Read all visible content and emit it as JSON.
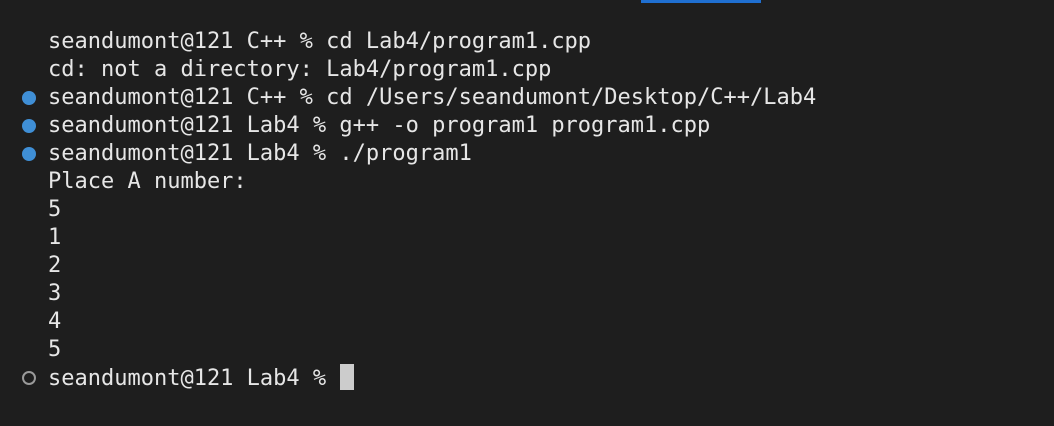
{
  "terminal": {
    "lines": [
      {
        "status": "error",
        "text": "seandumont@121 C++ % cd Lab4/program1.cpp"
      },
      {
        "status": "none",
        "text": "cd: not a directory: Lab4/program1.cpp"
      },
      {
        "status": "ok",
        "text": "seandumont@121 C++ % cd /Users/seandumont/Desktop/C++/Lab4"
      },
      {
        "status": "ok",
        "text": "seandumont@121 Lab4 % g++ -o program1 program1.cpp"
      },
      {
        "status": "ok",
        "text": "seandumont@121 Lab4 % ./program1"
      },
      {
        "status": "none",
        "text": "Place A number:"
      },
      {
        "status": "none",
        "text": "5"
      },
      {
        "status": "none",
        "text": "1"
      },
      {
        "status": "none",
        "text": "2"
      },
      {
        "status": "none",
        "text": "3"
      },
      {
        "status": "none",
        "text": "4"
      },
      {
        "status": "none",
        "text": "5"
      },
      {
        "status": "pending",
        "text": "seandumont@121 Lab4 %"
      }
    ]
  },
  "colors": {
    "background": "#1e1e1e",
    "text": "#e6e6e6",
    "ok_dot": "#3f8fd6",
    "error_icon": "#f14c4c",
    "active_tab": "#1f6fd1"
  }
}
